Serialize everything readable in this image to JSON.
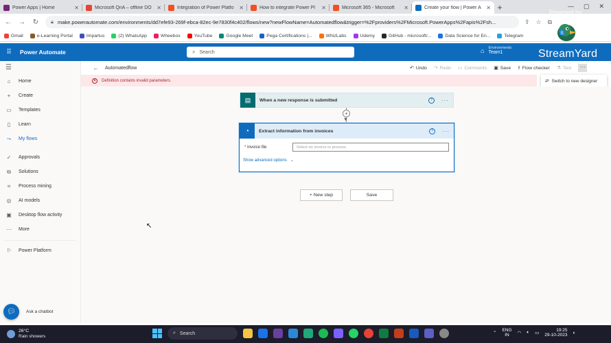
{
  "browser": {
    "tabs": [
      {
        "title": "Power Apps | Home",
        "color": "#742774"
      },
      {
        "title": "Microsoft QnA – offline DO",
        "color": "#ea4335"
      },
      {
        "title": "Integration of Power Platfo",
        "color": "#f25022"
      },
      {
        "title": "How to integrate Power Pl",
        "color": "#f25022"
      },
      {
        "title": "Microsoft 365 - Microsoft",
        "color": "#f25022"
      },
      {
        "title": "Create your flow | Power A",
        "color": "#0f6cbd"
      }
    ],
    "url": "make.powerautomate.com/environments/dd7efe93-269f-ebca-82ec-9e7830f4c402/flows/new?newFlowName=Automatedflow&trigger=%2Fproviders%2FMicrosoft.PowerApps%2Fapis%2Fsh...",
    "bookmarks": [
      {
        "label": "Gmail",
        "color": "#ea4335"
      },
      {
        "label": "e-Learning Portal",
        "color": "#8a5a2b"
      },
      {
        "label": "Impartus",
        "color": "#3f51b5"
      },
      {
        "label": "(2) WhatsApp",
        "color": "#25d366"
      },
      {
        "label": "Wheebox",
        "color": "#e91e63"
      },
      {
        "label": "YouTube",
        "color": "#ff0000"
      },
      {
        "label": "Google Meet",
        "color": "#00897b"
      },
      {
        "label": "Pega Certifications |...",
        "color": "#1565c0"
      },
      {
        "label": "WhizLabs",
        "color": "#ff6f00"
      },
      {
        "label": "Udemy",
        "color": "#a435f0"
      },
      {
        "label": "GitHub - microsoft/...",
        "color": "#24292e"
      },
      {
        "label": "Data Science for En...",
        "color": "#1a73e8"
      },
      {
        "label": "Telegram",
        "color": "#2aa1da"
      }
    ]
  },
  "app": {
    "name": "Power Automate",
    "search_placeholder": "Search",
    "env_label": "Environments",
    "env_name": "Team1",
    "overlay_powered": "Powered by",
    "overlay_brand": "StreamYard"
  },
  "nav": {
    "items": [
      {
        "label": "Home",
        "icon": "⌂"
      },
      {
        "label": "Create",
        "icon": "+"
      },
      {
        "label": "Templates",
        "icon": "▭"
      },
      {
        "label": "Learn",
        "icon": "▯"
      },
      {
        "label": "My flows",
        "icon": "⤳"
      },
      {
        "label": "Approvals",
        "icon": "✓"
      },
      {
        "label": "Solutions",
        "icon": "⧉"
      },
      {
        "label": "Process mining",
        "icon": "⌗"
      },
      {
        "label": "AI models",
        "icon": "◎"
      },
      {
        "label": "Desktop flow activity",
        "icon": "▣"
      },
      {
        "label": "More",
        "icon": "⋯"
      },
      {
        "label": "Power Platform",
        "icon": "⚐"
      }
    ],
    "chatbot": "Ask a chatbot"
  },
  "command": {
    "flow_name": "Automatedflow",
    "undo": "Undo",
    "redo": "Redo",
    "comments": "Comments",
    "save": "Save",
    "checker": "Flow checker",
    "test": "Test"
  },
  "error": "Definition contains invalid parameters.",
  "switch_designer": "Switch to new designer",
  "flow": {
    "trigger_title": "When a new response is submitted",
    "action_title": "Extract information from invoices",
    "field_label": "Invoice file",
    "field_placeholder": "Select an invoice to process",
    "advanced": "Show advanced options",
    "new_step": "+ New step",
    "save": "Save"
  },
  "taskbar": {
    "temp": "26°C",
    "weather": "Rain showers",
    "search": "Search",
    "lang1": "ENG",
    "lang2": "IN",
    "time": "19:25",
    "date": "29-10-2023"
  }
}
